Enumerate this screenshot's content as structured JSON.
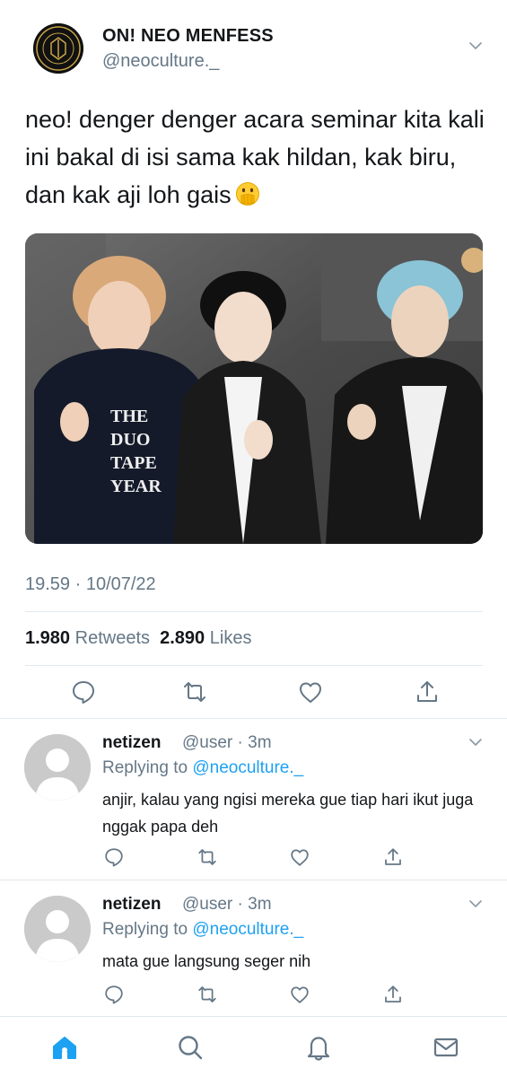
{
  "tweet": {
    "display_name": "ON! NEO MENFESS",
    "handle": "@neoculture._",
    "text": "neo! denger denger acara seminar kita kali ini bakal di isi sama kak hildan, kak biru, dan kak aji loh gais",
    "emoji": "face-with-hand-over-mouth",
    "timestamp": "19.59 · 10/07/22",
    "retweets_count": "1.980",
    "retweets_label": "Retweets",
    "likes_count": "2.890",
    "likes_label": "Likes"
  },
  "replies": [
    {
      "name": "netizen",
      "meta": "@user · 3m",
      "replying_label": "Replying to",
      "replying_handle": "@neoculture._",
      "text": "anjir, kalau yang ngisi mereka gue tiap hari ikut juga nggak papa deh"
    },
    {
      "name": "netizen",
      "meta": "@user · 3m",
      "replying_label": "Replying to",
      "replying_handle": "@neoculture._",
      "text": "mata gue langsung seger nih"
    }
  ],
  "icons": {
    "actions": [
      "reply-icon",
      "retweet-icon",
      "like-icon",
      "share-icon"
    ],
    "nav": [
      "home-icon",
      "search-icon",
      "notifications-icon",
      "messages-icon"
    ]
  },
  "colors": {
    "accent": "#1da1f2",
    "text": "#14171a",
    "secondary": "#657786",
    "divider": "#e1e8ed"
  }
}
